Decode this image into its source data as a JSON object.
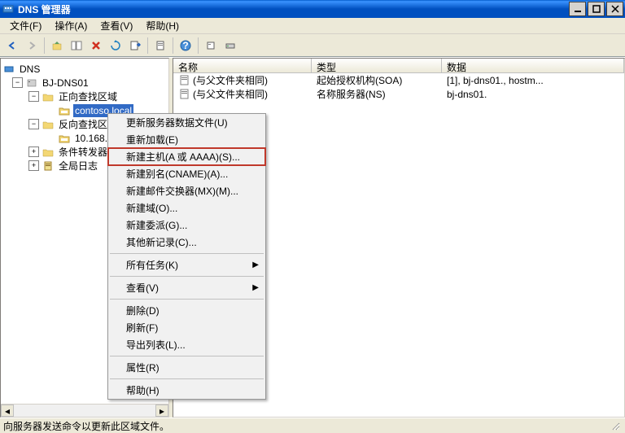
{
  "window": {
    "title": "DNS 管理器"
  },
  "menubar": {
    "file": "文件(F)",
    "action": "操作(A)",
    "view": "查看(V)",
    "help": "帮助(H)"
  },
  "tree": {
    "root": "DNS",
    "server": "BJ-DNS01",
    "fwd_zone": "正向查找区域",
    "contoso": "contoso.local",
    "rev_zone": "反向查找区域",
    "rev_item": "10.168...",
    "cond_fwd": "条件转发器",
    "global_log": "全局日志"
  },
  "list": {
    "columns": {
      "name": "名称",
      "type": "类型",
      "data": "数据"
    },
    "rows": [
      {
        "name": "(与父文件夹相同)",
        "type": "起始授权机构(SOA)",
        "data": "[1], bj-dns01., hostm..."
      },
      {
        "name": "(与父文件夹相同)",
        "type": "名称服务器(NS)",
        "data": "bj-dns01."
      }
    ]
  },
  "context_menu": {
    "update_file": "更新服务器数据文件(U)",
    "reload": "重新加载(E)",
    "new_host": "新建主机(A 或 AAAA)(S)...",
    "new_cname": "新建别名(CNAME)(A)...",
    "new_mx": "新建邮件交换器(MX)(M)...",
    "new_domain": "新建域(O)...",
    "new_delegation": "新建委派(G)...",
    "other_records": "其他新记录(C)...",
    "all_tasks": "所有任务(K)",
    "view": "查看(V)",
    "delete": "删除(D)",
    "refresh": "刷新(F)",
    "export_list": "导出列表(L)...",
    "properties": "属性(R)",
    "help": "帮助(H)"
  },
  "statusbar": {
    "text": "向服务器发送命令以更新此区域文件。"
  }
}
